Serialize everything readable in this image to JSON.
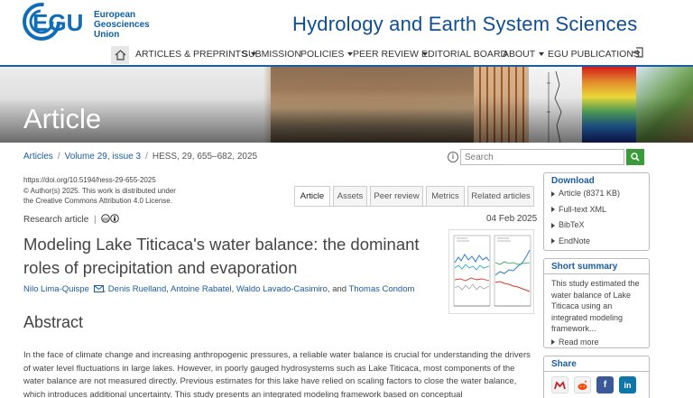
{
  "header": {
    "logo_letters": "EGU",
    "logo_text_line1": "European",
    "logo_text_line2": "Geosciences",
    "logo_text_line3": "Union",
    "journal_title": "Hydrology and Earth System Sciences"
  },
  "nav": {
    "items": [
      {
        "label": "ARTICLES & PREPRINTS",
        "dropdown": true
      },
      {
        "label": "SUBMISSION",
        "dropdown": false
      },
      {
        "label": "POLICIES",
        "dropdown": true
      },
      {
        "label": "PEER REVIEW",
        "dropdown": true
      },
      {
        "label": "EDITORIAL BOARD",
        "dropdown": false
      },
      {
        "label": "ABOUT",
        "dropdown": true
      },
      {
        "label": "EGU PUBLICATIONS",
        "dropdown": false
      }
    ]
  },
  "banner": {
    "title": "Article"
  },
  "breadcrumb": {
    "articles": "Articles",
    "volume": "Volume 29, issue 3",
    "citation": "HESS, 29, 655–682, 2025"
  },
  "search": {
    "placeholder": "Search"
  },
  "meta": {
    "doi": "https://doi.org/10.5194/hess-29-655-2025",
    "copyright": "© Author(s) 2025. This work is distributed under",
    "license": "the Creative Commons Attribution 4.0 License."
  },
  "tabs": [
    "Article",
    "Assets",
    "Peer review",
    "Metrics",
    "Related articles"
  ],
  "article": {
    "type": "Research article",
    "date": "04 Feb 2025",
    "title": "Modeling Lake Titicaca's water balance: the dominant roles of precipitation and evaporation",
    "authors": [
      "Nilo Lima-Quispe",
      "Denis Ruelland",
      "Antoine Rabatel",
      "Waldo Lavado-Casimiro",
      "Thomas Condom"
    ],
    "author_sep": ", ",
    "author_and": ", and "
  },
  "abstract": {
    "heading": "Abstract",
    "text": "In the face of climate change and increasing anthropogenic pressures, a reliable water balance is crucial for understanding the drivers of water level fluctuations in large lakes. However, in poorly gauged hydrosystems such as Lake Titicaca, most components of the water balance are not measured directly. Previous estimates for this lake have relied on scaling factors to close the water balance, which introduces additional uncertainty. This study presents an integrated modeling framework based on conceptual"
  },
  "sidebar": {
    "download": {
      "heading": "Download",
      "items": [
        "Article (8371 KB)",
        "Full-text XML",
        "BibTeX",
        "EndNote"
      ]
    },
    "summary": {
      "heading": "Short summary",
      "text": "This study estimated the water balance of Lake Titicaca using an integrated modeling framework...",
      "more": "Read more"
    },
    "share": {
      "heading": "Share"
    }
  },
  "colors": {
    "brand_blue": "#104e93",
    "link_blue": "#1c5da0",
    "search_green": "#3b9b3b"
  }
}
